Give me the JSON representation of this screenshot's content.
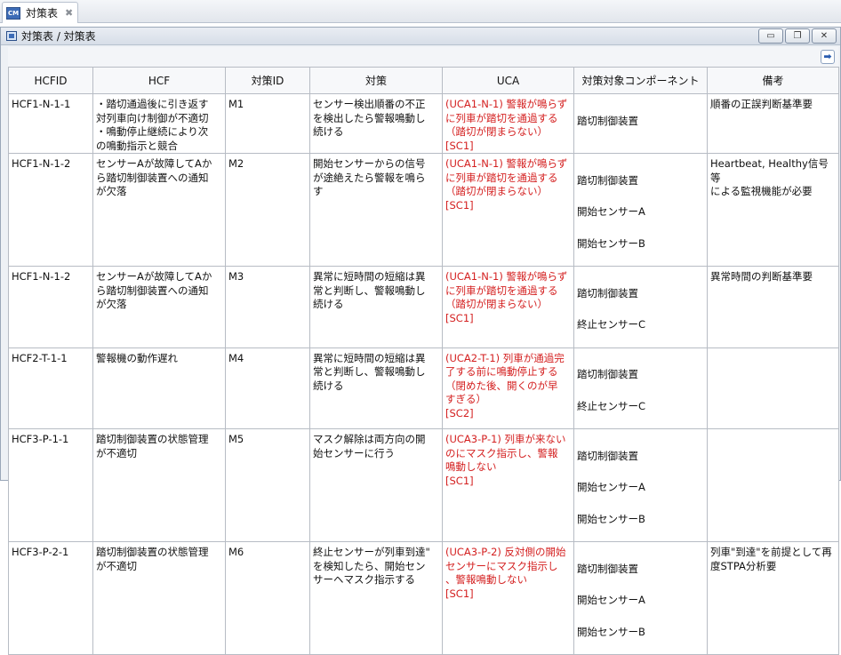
{
  "tab": {
    "icon": "table-icon",
    "label": "対策表",
    "close": "✖"
  },
  "panel": {
    "title": "対策表 / 対策表",
    "minimize": "▭",
    "restore": "❐",
    "close": "✕",
    "nav": "➡"
  },
  "table": {
    "headers": [
      "HCFID",
      "HCF",
      "対策ID",
      "対策",
      "UCA",
      "対策対象コンポーネント",
      "備考"
    ],
    "rows": [
      {
        "hcfid": "HCF1-N-1-1",
        "hcf": "・踏切通過後に引き返す\n対列車向け制御が不適切\n・鳴動停止継続により次\nの鳴動指示と競合",
        "mid": "M1",
        "measure": "センサー検出順番の不正\nを検出したら警報鳴動し\n続ける",
        "uca": "(UCA1-N-1) 警報が鳴らず\nに列車が踏切を通過する\n（踏切が閉まらない）\n[SC1]",
        "comp": [
          "踏切制御装置"
        ],
        "note": "順番の正誤判断基準要"
      },
      {
        "hcfid": "HCF1-N-1-2",
        "hcf": "センサーAが故障してAか\nら踏切制御装置への通知\nが欠落",
        "mid": "M2",
        "measure": "開始センサーからの信号\nが途絶えたら警報を鳴ら\nす",
        "uca": "(UCA1-N-1) 警報が鳴らず\nに列車が踏切を通過する\n（踏切が閉まらない）\n[SC1]",
        "comp": [
          "踏切制御装置",
          "開始センサーA",
          "開始センサーB"
        ],
        "note": "Heartbeat, Healthy信号等\nによる監視機能が必要"
      },
      {
        "hcfid": "HCF1-N-1-2",
        "hcf": "センサーAが故障してAか\nら踏切制御装置への通知\nが欠落",
        "mid": "M3",
        "measure": "異常に短時間の短縮は異\n常と判断し、警報鳴動し\n続ける",
        "uca": "(UCA1-N-1) 警報が鳴らず\nに列車が踏切を通過する\n（踏切が閉まらない）\n[SC1]",
        "comp": [
          "踏切制御装置",
          "終止センサーC"
        ],
        "note": "異常時間の判断基準要"
      },
      {
        "hcfid": "HCF2-T-1-1",
        "hcf": "警報機の動作遅れ",
        "mid": "M4",
        "measure": "異常に短時間の短縮は異\n常と判断し、警報鳴動し\n続ける",
        "uca": "(UCA2-T-1) 列車が通過完\n了する前に鳴動停止する\n（閉めた後、開くのが早\nすぎる）\n[SC2]",
        "comp": [
          "踏切制御装置",
          "終止センサーC"
        ],
        "note": ""
      },
      {
        "hcfid": "HCF3-P-1-1",
        "hcf": "踏切制御装置の状態管理\nが不適切",
        "mid": "M5",
        "measure": "マスク解除は両方向の開\n始センサーに行う",
        "uca": "(UCA3-P-1) 列車が来ない\nのにマスク指示し、警報\n鳴動しない\n[SC1]",
        "comp": [
          "踏切制御装置",
          "開始センサーA",
          "開始センサーB"
        ],
        "note": ""
      },
      {
        "hcfid": "HCF3-P-2-1",
        "hcf": "踏切制御装置の状態管理\nが不適切",
        "mid": "M6",
        "measure": "終止センサーが列車到達\"\nを検知したら、開始セン\nサーヘマスク指示する",
        "uca": "(UCA3-P-2) 反対側の開始\nセンサーにマスク指示し\n、警報鳴動しない\n[SC1]",
        "comp": [
          "踏切制御装置",
          "開始センサーA",
          "開始センサーB"
        ],
        "note": "列車\"到達\"を前提として再\n度STPA分析要"
      }
    ]
  }
}
